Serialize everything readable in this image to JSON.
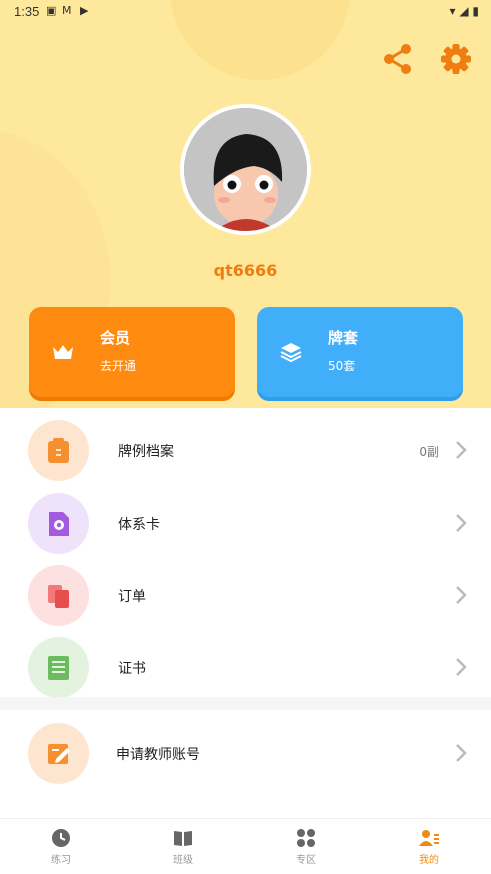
{
  "status_bar": {
    "time": "1:35",
    "icons": [
      "a-icon",
      "gmail-icon",
      "play-store-icon"
    ]
  },
  "header": {
    "username": "qt6666",
    "share_icon": "share-icon",
    "settings_icon": "gear-icon"
  },
  "cards": {
    "vip": {
      "title": "会员",
      "subtitle": "去开通",
      "color": "#ff8a10"
    },
    "deck": {
      "title": "牌套",
      "subtitle": "50套",
      "color": "#40aef8"
    }
  },
  "menu": [
    {
      "label": "牌例档案",
      "value": "0副",
      "icon": "clipboard-icon"
    },
    {
      "label": "体系卡",
      "value": "",
      "icon": "document-gear-icon"
    },
    {
      "label": "订单",
      "value": "",
      "icon": "order-icon"
    },
    {
      "label": "证书",
      "value": "",
      "icon": "certificate-icon"
    },
    {
      "label": "申请教师账号",
      "value": "",
      "icon": "edit-icon"
    }
  ],
  "tabs": [
    {
      "label": "练习",
      "active": false
    },
    {
      "label": "班级",
      "active": false
    },
    {
      "label": "专区",
      "active": false
    },
    {
      "label": "我的",
      "active": true
    }
  ],
  "colors": {
    "accent": "#ef7d10",
    "header_bg": "#fde89c"
  }
}
